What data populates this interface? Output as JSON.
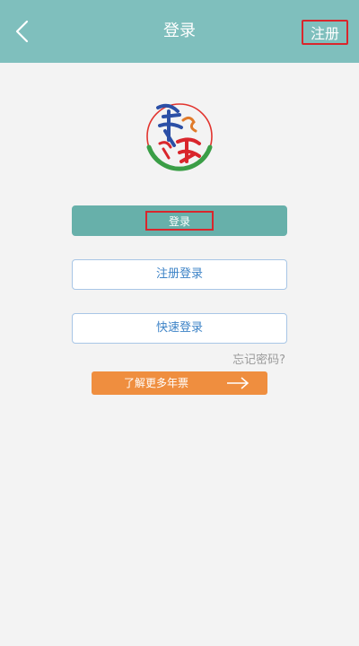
{
  "header": {
    "title": "登录",
    "register_label": "注册",
    "back_icon": "chevron-left-icon"
  },
  "logo": {
    "name": "app-logo-calligraphy"
  },
  "buttons": {
    "login": "登录",
    "register_login": "注册登录",
    "quick_login": "快速登录",
    "forgot_password": "忘记密码?",
    "learn_more": "了解更多年票"
  },
  "colors": {
    "header": "#7fbfbd",
    "primary": "#67b0aa",
    "accent": "#ef8e3f",
    "outline": "#a8c6e6",
    "highlight": "#d9262c"
  }
}
